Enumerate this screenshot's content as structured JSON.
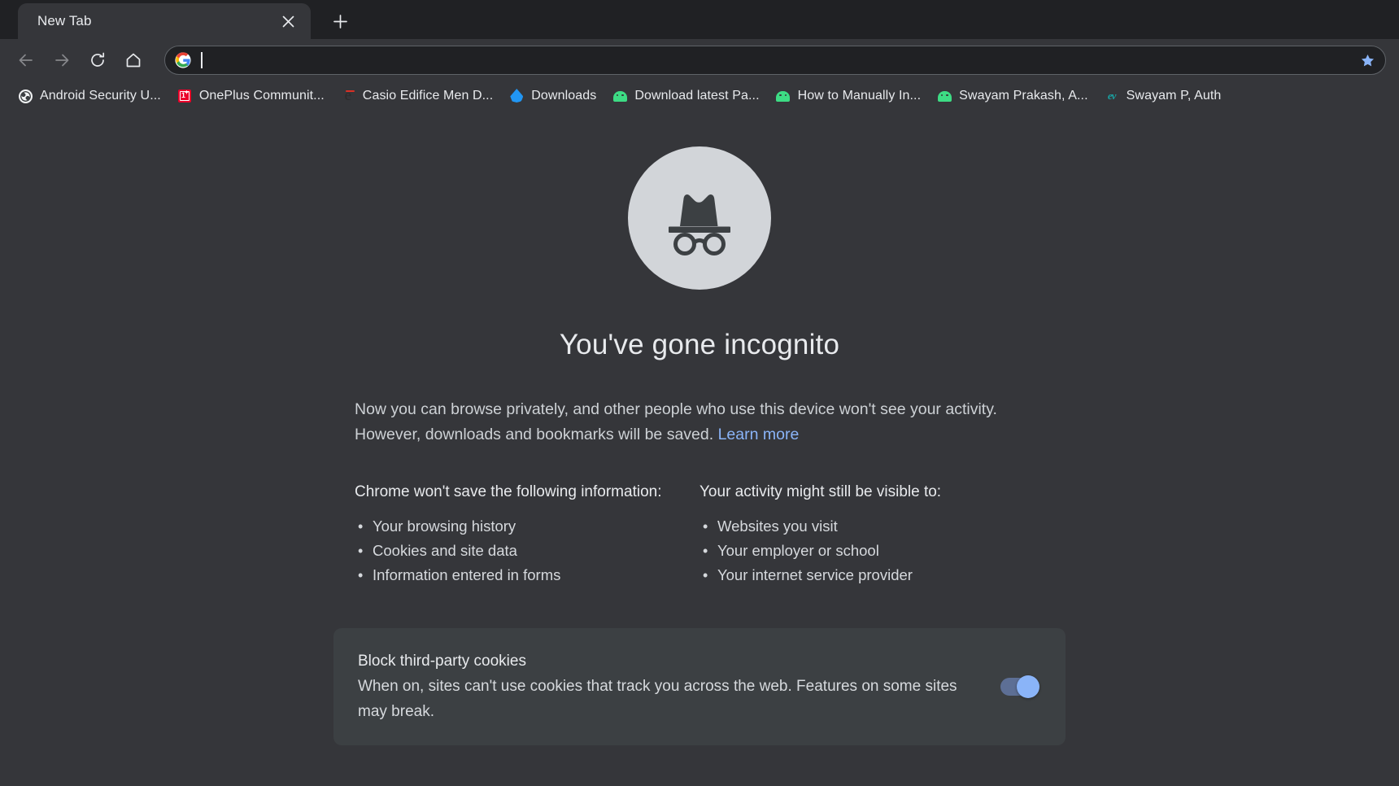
{
  "window": {
    "tab": {
      "title": "New Tab",
      "close_icon": "close-icon",
      "new_tab_icon": "plus-icon"
    },
    "toolbar": {
      "back_icon": "arrow-left-icon",
      "forward_icon": "arrow-right-icon",
      "reload_icon": "reload-icon",
      "home_icon": "home-icon",
      "omnibox": {
        "value": "",
        "placeholder": "",
        "leading_icon": "google-g-icon",
        "trailing_icon": "star-icon"
      }
    }
  },
  "bookmarks": [
    {
      "label": "Android Security U...",
      "icon": "globe-favicon"
    },
    {
      "label": "OnePlus Communit...",
      "icon": "oneplus-favicon"
    },
    {
      "label": "Casio Edifice Men D...",
      "icon": "edge-e-favicon"
    },
    {
      "label": "Downloads",
      "icon": "blue-droplet-favicon"
    },
    {
      "label": "Download latest Pa...",
      "icon": "android-favicon"
    },
    {
      "label": "How to Manually In...",
      "icon": "android-favicon"
    },
    {
      "label": "Swayam Prakash, A...",
      "icon": "android-favicon"
    },
    {
      "label": "Swayam P, Auth",
      "icon": "ev-monogram-favicon"
    }
  ],
  "incognito": {
    "icon": "incognito-hat-glasses-icon",
    "headline": "You've gone incognito",
    "intro_line1": "Now you can browse privately, and other people who use this device won't see your activity.",
    "intro_line2": "However, downloads and bookmarks will be saved.",
    "learn_more": "Learn more",
    "wont_save": {
      "heading": "Chrome won't save the following information:",
      "items": [
        "Your browsing history",
        "Cookies and site data",
        "Information entered in forms"
      ]
    },
    "still_visible": {
      "heading": "Your activity might still be visible to:",
      "items": [
        "Websites you visit",
        "Your employer or school",
        "Your internet service provider"
      ]
    },
    "cookie_card": {
      "title": "Block third-party cookies",
      "description": "When on, sites can't use cookies that track you across the web. Features on some sites may break.",
      "toggle_state": "on"
    }
  },
  "colors": {
    "tab_strip_bg": "#202124",
    "toolbar_bg": "#35363a",
    "page_bg": "#35363a",
    "card_bg": "#3c4043",
    "accent_blue": "#8ab4f8",
    "text_primary": "#e8eaed",
    "incognito_circle": "#d2d5d9",
    "incognito_glyph": "#3c4043"
  }
}
